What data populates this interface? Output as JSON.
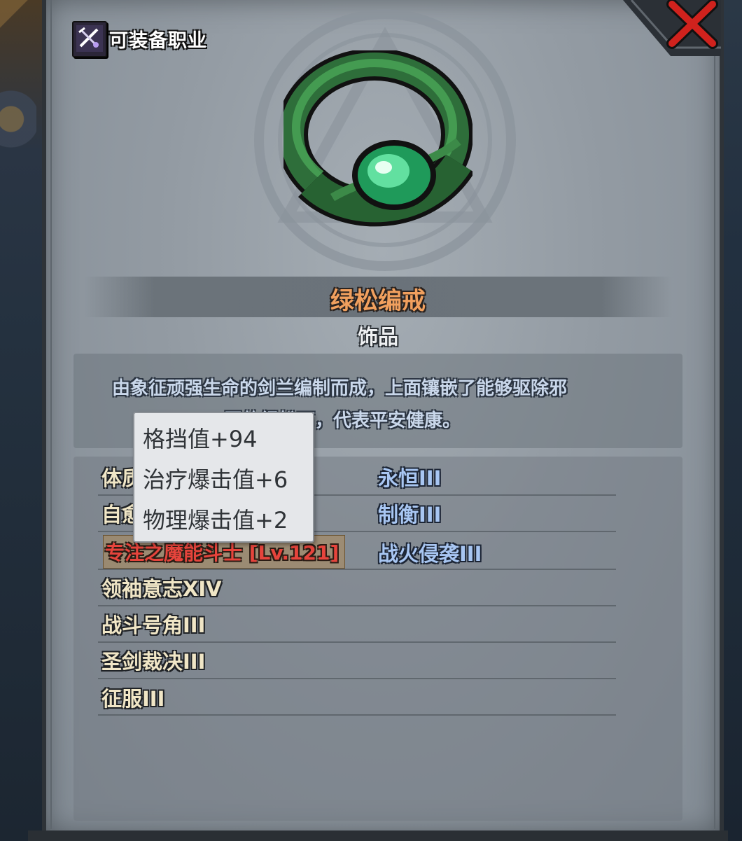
{
  "header": {
    "class_label": "可装备职业"
  },
  "item": {
    "name": "绿松编戒",
    "type": "饰品",
    "description_line1": "由象征顽强生命的剑兰编制而成，上面镶嵌了能够驱除邪",
    "description_line2": "恶的绿松石，代表平安健康。"
  },
  "skills": {
    "left": [
      {
        "text": "体质"
      },
      {
        "text": "自愈"
      },
      {
        "text": "专注之魔能斗士 [Lv.121]"
      },
      {
        "text": "领袖意志XIV"
      },
      {
        "text": "战斗号角III"
      },
      {
        "text": "圣剑裁决III"
      },
      {
        "text": "征服III"
      }
    ],
    "right": [
      {
        "text": "永恒III"
      },
      {
        "text": "制衡III"
      },
      {
        "text": "战火侵袭III"
      }
    ]
  },
  "tooltip": {
    "lines": [
      "格挡值+94",
      "治疗爆击值+6",
      "物理爆击值+2"
    ]
  },
  "colors": {
    "item_name": "#f1a05e",
    "skill_default": "#f0e6c6",
    "skill_blue": "#a8c6f2",
    "skill_active": "#e6443c",
    "close_red": "#d0221d"
  },
  "icons": {
    "class_badge": "sword-wand-icon",
    "close": "close-x-icon",
    "item": "green-ring-icon"
  }
}
